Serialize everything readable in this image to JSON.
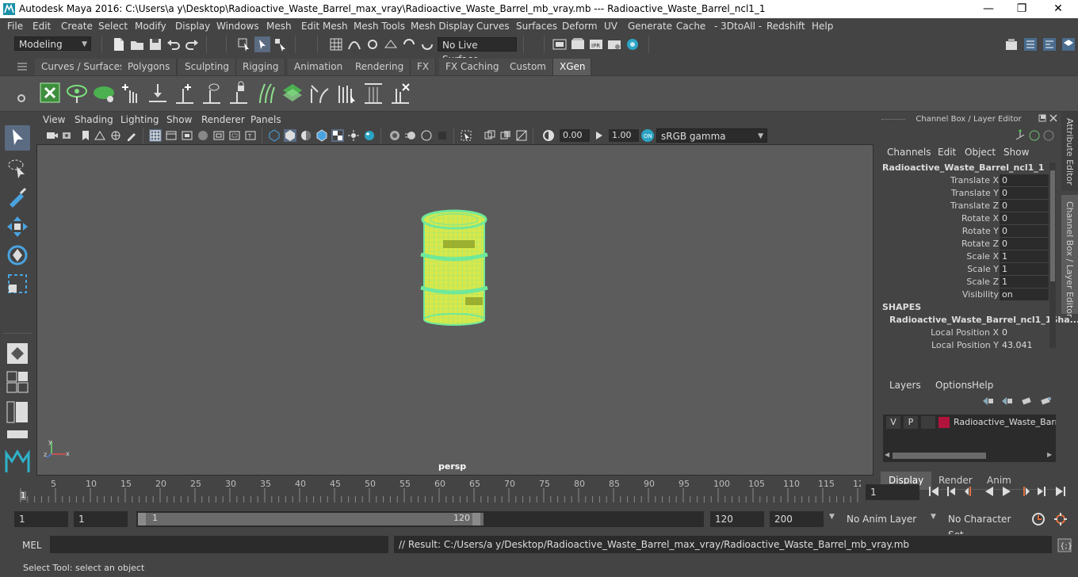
{
  "window": {
    "title": "Autodesk Maya 2016: C:\\Users\\a y\\Desktop\\Radioactive_Waste_Barrel_max_vray\\Radioactive_Waste_Barrel_mb_vray.mb   ---   Radioactive_Waste_Barrel_ncl1_1",
    "minimize": "—",
    "maximize": "❐",
    "close": "✕"
  },
  "menu": [
    "File",
    "Edit",
    "Create",
    "Select",
    "Modify",
    "Display",
    "Windows",
    "Mesh",
    "Edit Mesh",
    "Mesh Tools",
    "Mesh Display",
    "Curves",
    "Surfaces",
    "Deform",
    "UV",
    "Generate",
    "Cache",
    "- 3DtoAll -",
    "Redshift",
    "Help"
  ],
  "status": {
    "mode": "Modeling",
    "live_surface": "No Live Surface"
  },
  "shelf_tabs": [
    "Curves / Surfaces",
    "Polygons",
    "Sculpting",
    "Rigging",
    "Animation",
    "Rendering",
    "FX",
    "FX Caching",
    "Custom",
    "XGen"
  ],
  "active_shelf_tab": "XGen",
  "viewport": {
    "menu": [
      "View",
      "Shading",
      "Lighting",
      "Show",
      "Renderer",
      "Panels"
    ],
    "field_a": "0.00",
    "field_b": "1.00",
    "color_space": "sRGB gamma",
    "camera": "persp",
    "axis_y": "y",
    "axis_x": "x",
    "axis_z": "z"
  },
  "channel_box": {
    "title": "Channel Box / Layer Editor",
    "menu": [
      "Channels",
      "Edit",
      "Object",
      "Show"
    ],
    "object": "Radioactive_Waste_Barrel_ncl1_1",
    "attributes": [
      {
        "label": "Translate X",
        "value": "0"
      },
      {
        "label": "Translate Y",
        "value": "0"
      },
      {
        "label": "Translate Z",
        "value": "0"
      },
      {
        "label": "Rotate X",
        "value": "0"
      },
      {
        "label": "Rotate Y",
        "value": "0"
      },
      {
        "label": "Rotate Z",
        "value": "0"
      },
      {
        "label": "Scale X",
        "value": "1"
      },
      {
        "label": "Scale Y",
        "value": "1"
      },
      {
        "label": "Scale Z",
        "value": "1"
      },
      {
        "label": "Visibility",
        "value": "on"
      }
    ],
    "shapes_header": "SHAPES",
    "shape_name": "Radioactive_Waste_Barrel_ncl1_1Sha...",
    "shape_attributes": [
      {
        "label": "Local Position X",
        "value": "0"
      },
      {
        "label": "Local Position Y",
        "value": "43.041"
      }
    ],
    "side_tabs": [
      "Attribute Editor",
      "Channel Box / Layer Editor"
    ]
  },
  "layer_editor": {
    "tabs": [
      "Display",
      "Render",
      "Anim"
    ],
    "active_tab": "Display",
    "menu": [
      "Layers",
      "Options",
      "Help"
    ],
    "layer": {
      "v": "V",
      "p": "P",
      "name": "Radioactive_Waste_Barrel",
      "color": "#b0143c"
    }
  },
  "timeline": {
    "ticks": [
      "1",
      "5",
      "10",
      "15",
      "20",
      "25",
      "30",
      "35",
      "40",
      "45",
      "50",
      "55",
      "60",
      "65",
      "70",
      "75",
      "80",
      "85",
      "90",
      "95",
      "100",
      "105",
      "110",
      "115",
      "12"
    ],
    "current_frame": "1"
  },
  "range": {
    "start": "1",
    "playback_start": "1",
    "slider_start": "1",
    "slider_end": "120",
    "playback_end": "120",
    "end": "200",
    "anim_layer": "No Anim Layer",
    "character_set": "No Character Set"
  },
  "command": {
    "lang": "MEL",
    "result": "// Result: C:/Users/a y/Desktop/Radioactive_Waste_Barrel_max_vray/Radioactive_Waste_Barrel_mb_vray.mb"
  },
  "help_line": "Select Tool: select an object",
  "colors": {
    "accent": "#5a6b82",
    "mesh_wire": "#6fe89a",
    "mesh_fill": "#d8e84a"
  }
}
